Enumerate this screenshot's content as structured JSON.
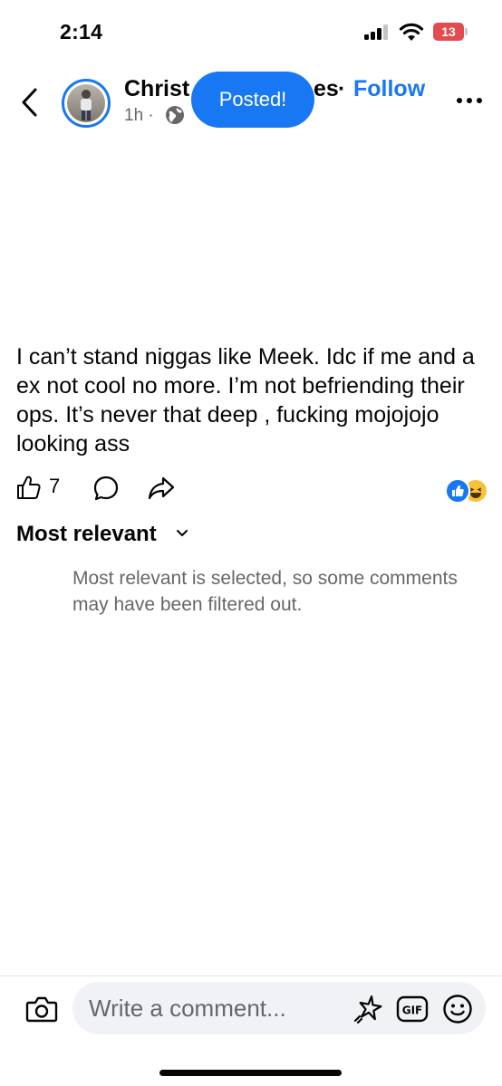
{
  "status_bar": {
    "time": "2:14",
    "battery": "13"
  },
  "header": {
    "author_start": "Christ",
    "author_end": "es",
    "follow_label": "Follow",
    "time_ago": "1h ·",
    "toast": "Posted!"
  },
  "post": {
    "text": "I can’t stand niggas like Meek. Idc if me and a ex not cool no more. I’m not befriending their ops. It’s never that deep , fucking mojojojo looking ass",
    "like_count": "7"
  },
  "comments": {
    "sort_label": "Most relevant",
    "filter_note": "Most relevant is selected, so some comments may have been filtered out."
  },
  "composer": {
    "placeholder": "Write a comment..."
  },
  "colors": {
    "accent": "#1877f2",
    "battery_low": "#e24b4f"
  }
}
